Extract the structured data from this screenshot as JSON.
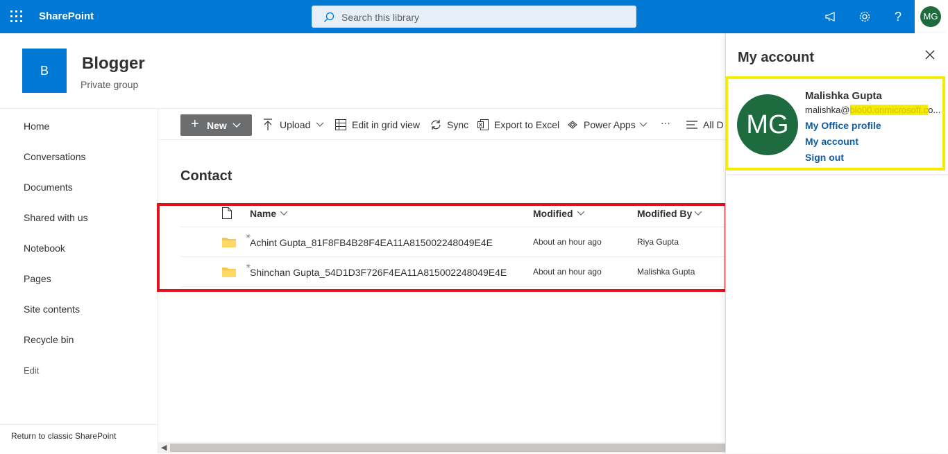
{
  "topbar": {
    "brand": "SharePoint",
    "search_placeholder": "Search this library",
    "avatar_initials": "MG",
    "icons": [
      "waffle-icon",
      "megaphone-icon",
      "gear-icon",
      "help-icon"
    ]
  },
  "site": {
    "logo_letter": "B",
    "title": "Blogger",
    "subtitle": "Private group"
  },
  "nav": {
    "items": [
      "Home",
      "Conversations",
      "Documents",
      "Shared with us",
      "Notebook",
      "Pages",
      "Site contents",
      "Recycle bin"
    ],
    "edit": "Edit",
    "classic_link": "Return to classic SharePoint"
  },
  "commands": {
    "new": "New",
    "upload": "Upload",
    "grid": "Edit in grid view",
    "sync": "Sync",
    "export": "Export to Excel",
    "powerapps": "Power Apps",
    "more": "···",
    "view": "All D"
  },
  "library": {
    "title": "Contact",
    "columns": {
      "name": "Name",
      "modified": "Modified",
      "modified_by": "Modified By"
    },
    "rows": [
      {
        "name": "Achint Gupta_81F8FB4B28F4EA11A815002248049E4E",
        "modified": "About an hour ago",
        "modified_by": "Riya Gupta"
      },
      {
        "name": "Shinchan Gupta_54D1D3F726F4EA11A815002248049E4E",
        "modified": "About an hour ago",
        "modified_by": "Malishka Gupta"
      }
    ]
  },
  "account": {
    "panel_title": "My account",
    "initials": "MG",
    "name": "Malishka Gupta",
    "email_visible": "malishka@",
    "email_redacted": "blo00.onmicrosoft.c",
    "email_tail": "o...",
    "links": {
      "profile": "My Office profile",
      "account": "My account",
      "signout": "Sign out"
    }
  },
  "colors": {
    "suite_bar": "#0078d4",
    "avatar": "#1e6b3f",
    "highlight_red": "#e1121c",
    "highlight_yellow": "#f5ec00",
    "link": "#0f5ea5"
  }
}
